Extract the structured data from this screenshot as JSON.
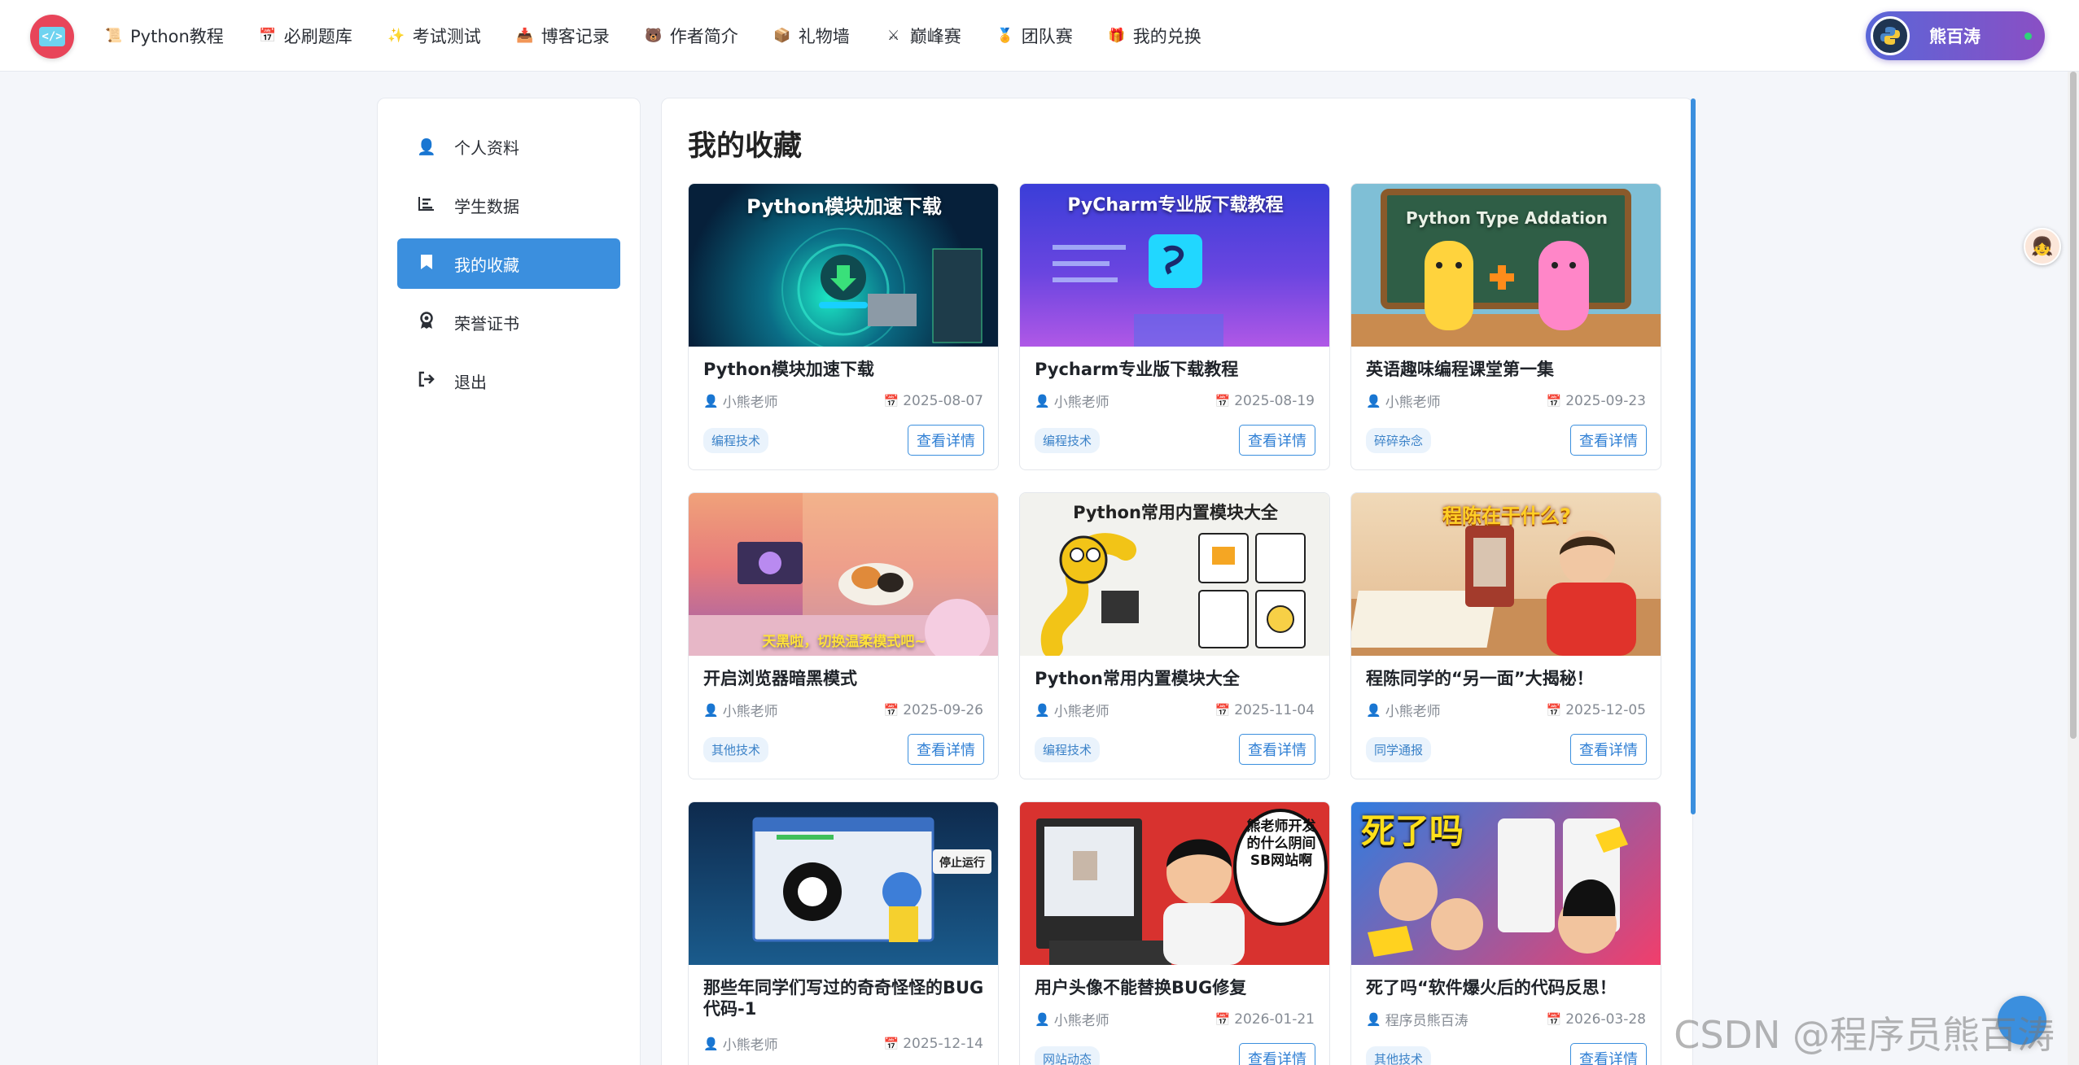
{
  "nav": {
    "items": [
      {
        "label": "Python教程",
        "icon": "scroll-icon"
      },
      {
        "label": "必刷题库",
        "icon": "calendar-icon"
      },
      {
        "label": "考试测试",
        "icon": "sparkles-icon"
      },
      {
        "label": "博客记录",
        "icon": "inbox-tray-icon"
      },
      {
        "label": "作者简介",
        "icon": "bear-icon"
      },
      {
        "label": "礼物墙",
        "icon": "package-icon"
      },
      {
        "label": "巅峰赛",
        "icon": "crossed-swords-icon"
      },
      {
        "label": "团队赛",
        "icon": "medal-icon"
      },
      {
        "label": "我的兑换",
        "icon": "gift-icon"
      }
    ],
    "user_name": "熊百涛"
  },
  "sidebar": {
    "items": [
      {
        "label": "个人资料",
        "icon": "user-icon"
      },
      {
        "label": "学生数据",
        "icon": "bar-chart-icon"
      },
      {
        "label": "我的收藏",
        "icon": "bookmark-icon"
      },
      {
        "label": "荣誉证书",
        "icon": "award-icon"
      },
      {
        "label": "退出",
        "icon": "sign-out-icon"
      }
    ]
  },
  "main": {
    "title": "我的收藏",
    "detail_label": "查看详情",
    "cards": [
      {
        "title": "Python模块加速下载",
        "author": "小熊老师",
        "date": "2025-08-07",
        "tag": "编程技术",
        "thumb_text": "Python模块加速下载"
      },
      {
        "title": "Pycharm专业版下载教程",
        "author": "小熊老师",
        "date": "2025-08-19",
        "tag": "编程技术",
        "thumb_text": "PyCharm专业版下载教程"
      },
      {
        "title": "英语趣味编程课堂第一集",
        "author": "小熊老师",
        "date": "2025-09-23",
        "tag": "碎碎杂念",
        "thumb_text": "Python Type Addation"
      },
      {
        "title": "开启浏览器暗黑模式",
        "author": "小熊老师",
        "date": "2025-09-26",
        "tag": "其他技术",
        "thumb_text": "天黑啦，切换温柔模式吧~"
      },
      {
        "title": "Python常用内置模块大全",
        "author": "小熊老师",
        "date": "2025-11-04",
        "tag": "编程技术",
        "thumb_text": "Python常用内置模块大全"
      },
      {
        "title": "程陈同学的“另一面”大揭秘！",
        "author": "小熊老师",
        "date": "2025-12-05",
        "tag": "同学通报",
        "thumb_text": "程陈在干什么?"
      },
      {
        "title": "那些年同学们写过的奇奇怪怪的BUG代码-1",
        "author": "小熊老师",
        "date": "2025-12-14",
        "tag": "",
        "thumb_text": "停止运行"
      },
      {
        "title": "用户头像不能替换BUG修复",
        "author": "小熊老师",
        "date": "2026-01-21",
        "tag": "网站动态",
        "thumb_text": "熊老师开发的什么阴间SB网站啊"
      },
      {
        "title": "死了吗“软件爆火后的代码反思！",
        "author": "程序员熊百涛",
        "date": "2026-03-28",
        "tag": "其他技术",
        "thumb_text": "死了吗"
      }
    ]
  },
  "watermark": "CSDN @程序员熊百涛",
  "colors": {
    "accent": "#3b8fde",
    "logo": "#e8455a"
  }
}
